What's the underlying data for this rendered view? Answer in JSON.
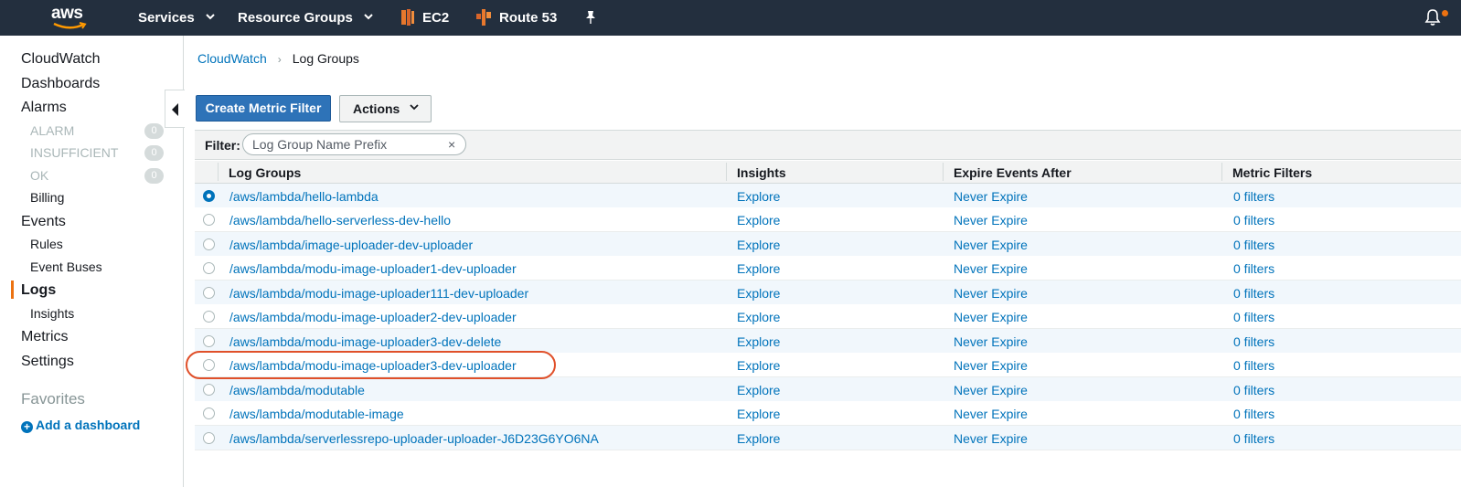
{
  "topnav": {
    "logo_text": "aws",
    "services_label": "Services",
    "resource_groups_label": "Resource Groups",
    "ec2_label": "EC2",
    "route53_label": "Route 53"
  },
  "sidebar": {
    "cloudwatch": "CloudWatch",
    "dashboards": "Dashboards",
    "alarms": "Alarms",
    "alarm_states": [
      {
        "label": "ALARM",
        "count": "0"
      },
      {
        "label": "INSUFFICIENT",
        "count": "0"
      },
      {
        "label": "OK",
        "count": "0"
      }
    ],
    "billing": "Billing",
    "events": "Events",
    "rules": "Rules",
    "event_buses": "Event Buses",
    "logs": "Logs",
    "insights": "Insights",
    "metrics": "Metrics",
    "settings": "Settings",
    "favorites": "Favorites",
    "add_dashboard": "Add a dashboard"
  },
  "breadcrumb": {
    "parent": "CloudWatch",
    "current": "Log Groups"
  },
  "toolbar": {
    "create_metric_filter": "Create Metric Filter",
    "actions": "Actions"
  },
  "filter": {
    "label": "Filter:",
    "placeholder": "Log Group Name Prefix",
    "clear": "×"
  },
  "table": {
    "columns": [
      "Log Groups",
      "Insights",
      "Expire Events After",
      "Metric Filters"
    ],
    "rows": [
      {
        "name": "/aws/lambda/hello-lambda",
        "insights": "Explore",
        "expire": "Never Expire",
        "filters": "0 filters",
        "selected": true
      },
      {
        "name": "/aws/lambda/hello-serverless-dev-hello",
        "insights": "Explore",
        "expire": "Never Expire",
        "filters": "0 filters",
        "selected": false
      },
      {
        "name": "/aws/lambda/image-uploader-dev-uploader",
        "insights": "Explore",
        "expire": "Never Expire",
        "filters": "0 filters",
        "selected": false
      },
      {
        "name": "/aws/lambda/modu-image-uploader1-dev-uploader",
        "insights": "Explore",
        "expire": "Never Expire",
        "filters": "0 filters",
        "selected": false
      },
      {
        "name": "/aws/lambda/modu-image-uploader111-dev-uploader",
        "insights": "Explore",
        "expire": "Never Expire",
        "filters": "0 filters",
        "selected": false
      },
      {
        "name": "/aws/lambda/modu-image-uploader2-dev-uploader",
        "insights": "Explore",
        "expire": "Never Expire",
        "filters": "0 filters",
        "selected": false
      },
      {
        "name": "/aws/lambda/modu-image-uploader3-dev-delete",
        "insights": "Explore",
        "expire": "Never Expire",
        "filters": "0 filters",
        "selected": false
      },
      {
        "name": "/aws/lambda/modu-image-uploader3-dev-uploader",
        "insights": "Explore",
        "expire": "Never Expire",
        "filters": "0 filters",
        "selected": false
      },
      {
        "name": "/aws/lambda/modutable",
        "insights": "Explore",
        "expire": "Never Expire",
        "filters": "0 filters",
        "selected": false
      },
      {
        "name": "/aws/lambda/modutable-image",
        "insights": "Explore",
        "expire": "Never Expire",
        "filters": "0 filters",
        "selected": false
      },
      {
        "name": "/aws/lambda/serverlessrepo-uploader-uploader-J6D23G6YO6NA",
        "insights": "Explore",
        "expire": "Never Expire",
        "filters": "0 filters",
        "selected": false
      }
    ]
  },
  "colors": {
    "nav_bg": "#232f3e",
    "link": "#0073bb",
    "accent": "#ec7211",
    "annotation": "#e0502a"
  }
}
